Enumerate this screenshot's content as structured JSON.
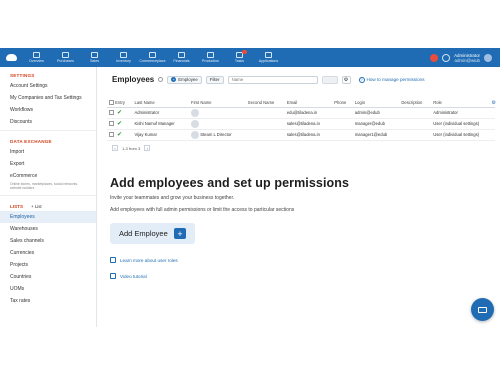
{
  "topnav": {
    "items": [
      {
        "label": "Overview",
        "icon": "chart-icon"
      },
      {
        "label": "Purchases",
        "icon": "purchases-icon"
      },
      {
        "label": "Sales",
        "icon": "bag-icon"
      },
      {
        "label": "Inventory",
        "icon": "box-icon"
      },
      {
        "label": "Commerceplace",
        "icon": "cart-icon"
      },
      {
        "label": "Financials",
        "icon": "money-icon"
      },
      {
        "label": "Production",
        "icon": "factory-icon"
      },
      {
        "label": "Tasks",
        "icon": "tasks-icon"
      },
      {
        "label": "Applications",
        "icon": "apps-icon"
      }
    ],
    "account_name": "Administrator",
    "account_sub": "admin@wiub"
  },
  "sidebar": {
    "settings_head": "SETTINGS",
    "settings_items": [
      "Account Settings",
      "My Companies and Tax Settings",
      "Workflows",
      "Discounts"
    ],
    "exchange_head": "DATA EXCHANGE",
    "exchange_items": [
      "Import",
      "Export",
      "eCommerce"
    ],
    "ecommerce_note": "Online stores, marketplaces, social networks, website builders",
    "lists_head": "LISTS",
    "list_button": "+ List",
    "list_items": [
      "Employees",
      "Warehouses",
      "Sales channels",
      "Currencies",
      "Projects",
      "Countries",
      "UOMs",
      "Tax rates"
    ],
    "active_item": "Employees"
  },
  "main": {
    "title": "Employees",
    "add_button": "Employee",
    "filter_button": "Filter",
    "name_placeholder": "Name",
    "help_link": "How to manage permissions",
    "columns": [
      "Entry",
      "Last Name",
      "First Name",
      "Second Name",
      "Email",
      "Phone",
      "Login",
      "Description",
      "Role"
    ],
    "rows": [
      {
        "last": "Administrator",
        "first": "",
        "second": "",
        "email": "edu@tiladena.in",
        "phone": "",
        "login": "admin@edub",
        "desc": "",
        "role": "Administrator"
      },
      {
        "last": "Kishi Namuf Manager",
        "first": "",
        "second": "",
        "email": "sales@tiladena.in",
        "phone": "",
        "login": "manager@edub",
        "desc": "",
        "role": "User (individual settings)"
      },
      {
        "last": "Vijay Kumar",
        "first": "Steam L Director",
        "second": "",
        "email": "sales@tiladena.in",
        "phone": "",
        "login": "manager1@edub",
        "desc": "",
        "role": "User (individual settings)"
      }
    ],
    "pager": "1-3 from 3"
  },
  "hero": {
    "title": "Add employees and set up permissions",
    "line1": "Invite your teammates and grow your business together.",
    "line2": "Add employees with full admin permissions or limit the access to particular sections",
    "add_employee": "Add Employee",
    "learn_more": "Learn more about user roles",
    "video": "Video tutorial"
  }
}
